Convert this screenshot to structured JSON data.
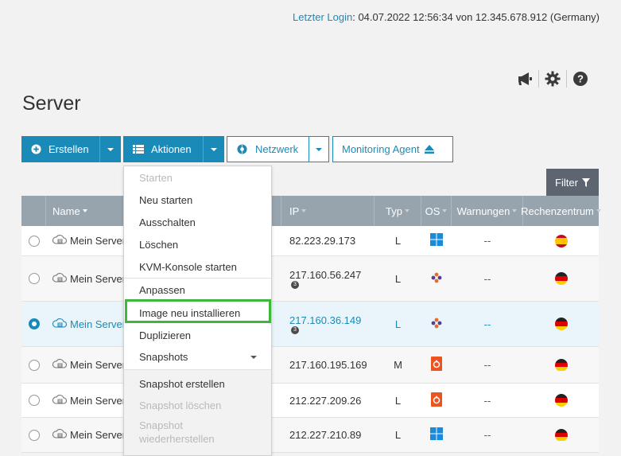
{
  "header": {
    "login_label": "Letzter Login",
    "login_text": ": 04.07.2022 12:56:34 von 12.345.678.912 (Germany)"
  },
  "top_icons": [
    "megaphone-icon",
    "gear-icon",
    "help-icon"
  ],
  "page_title": "Server",
  "toolbar": {
    "create_label": "Erstellen",
    "actions_label": "Aktionen",
    "network_label": "Netzwerk",
    "monitoring_label": "Monitoring Agent"
  },
  "filter_label": "Filter",
  "table": {
    "headers": {
      "name": "Name",
      "ip": "IP",
      "type": "Typ",
      "os": "OS",
      "warnings": "Warnungen",
      "datacenter": "Rechenzentrum"
    },
    "rows": [
      {
        "name": "Mein Server",
        "ip": "82.223.29.173",
        "type": "L",
        "os": "windows",
        "warnings": "--",
        "flag": "es",
        "selected": false
      },
      {
        "name": "Mein Server",
        "ip": "217.160.56.247",
        "type": "L",
        "os": "plesk",
        "warnings": "--",
        "flag": "de",
        "selected": false
      },
      {
        "name": "Mein Server",
        "ip": "217.160.36.149",
        "type": "L",
        "os": "plesk",
        "warnings": "--",
        "flag": "de",
        "selected": true
      },
      {
        "name": "Mein Server",
        "ip": "217.160.195.169",
        "type": "M",
        "os": "ubuntu",
        "warnings": "--",
        "flag": "de",
        "selected": false
      },
      {
        "name": "Mein Server",
        "ip": "212.227.209.26",
        "type": "L",
        "os": "ubuntu",
        "warnings": "--",
        "flag": "de",
        "selected": false
      },
      {
        "name": "Mein Server",
        "ip": "212.227.210.89",
        "type": "L",
        "os": "windows",
        "warnings": "--",
        "flag": "de",
        "selected": false
      }
    ]
  },
  "actions_menu": {
    "items": [
      {
        "label": "Starten",
        "disabled": true
      },
      {
        "label": "Neu starten",
        "disabled": false
      },
      {
        "label": "Ausschalten",
        "disabled": false
      },
      {
        "label": "Löschen",
        "disabled": false
      },
      {
        "label": "KVM-Konsole starten",
        "disabled": false
      },
      {
        "label": "Anpassen",
        "disabled": false
      },
      {
        "label": "Image neu installieren",
        "disabled": false,
        "highlighted": true
      },
      {
        "label": "Duplizieren",
        "disabled": false
      },
      {
        "label": "Snapshots",
        "disabled": false,
        "submenu": true
      },
      {
        "label": "Snapshot erstellen",
        "disabled": false
      },
      {
        "label": "Snapshot löschen",
        "disabled": true
      },
      {
        "label": "Snapshot wiederherstellen",
        "disabled": true
      }
    ]
  },
  "colors": {
    "accent": "#1a8bb9",
    "table_header": "#97a3ad",
    "highlight_border": "#3db83b",
    "filter_button": "#5d6670"
  }
}
